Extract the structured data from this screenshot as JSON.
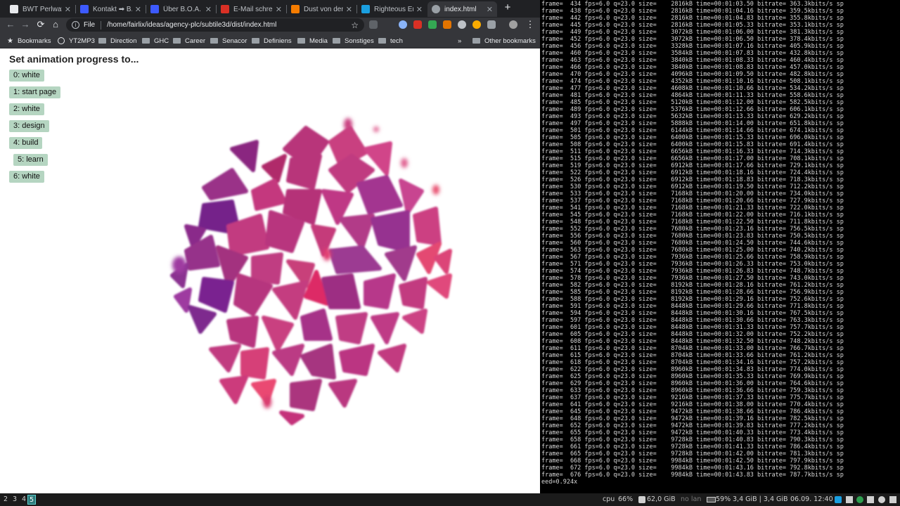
{
  "browser": {
    "tabs": [
      {
        "title": "BWT Perlwater",
        "favicon_color": "#e8eaed",
        "active": false
      },
      {
        "title": "Kontakt ➡ B.O",
        "favicon_color": "#3d5afe",
        "active": false
      },
      {
        "title": "Über B.O.A. Vi",
        "favicon_color": "#3d5afe",
        "active": false
      },
      {
        "title": "E-Mail schreib",
        "favicon_color": "#d93025",
        "active": false
      },
      {
        "title": "Dust von den",
        "favicon_color": "#f57c00",
        "active": false
      },
      {
        "title": "Righteous Ene",
        "favicon_color": "#1a9fe0",
        "active": false
      },
      {
        "title": "index.html",
        "favicon_color": "#9aa0a6",
        "active": true
      }
    ],
    "newtab_label": "+",
    "nav": {
      "back": "←",
      "forward": "→",
      "reload": "⟳",
      "home": "⌂"
    },
    "omnibox": {
      "scheme": "File",
      "url": "/home/fairlix/ideas/agency-plc/subtile3d/dist/index.html",
      "info_icon": "i",
      "star_icon": "☆"
    },
    "menu_icon": "⋮",
    "bookmarks": [
      {
        "label": "Bookmarks",
        "icon": "star-icon"
      },
      {
        "label": "YT2MP3",
        "icon": "globe-icon"
      },
      {
        "label": "Direction",
        "icon": "folder-icon"
      },
      {
        "label": "GHC",
        "icon": "folder-icon"
      },
      {
        "label": "Career",
        "icon": "folder-icon"
      },
      {
        "label": "Senacor",
        "icon": "folder-icon"
      },
      {
        "label": "Definiens",
        "icon": "folder-icon"
      },
      {
        "label": "Media",
        "icon": "folder-icon"
      },
      {
        "label": "Sonstiges",
        "icon": "folder-icon"
      },
      {
        "label": "tech",
        "icon": "folder-icon"
      }
    ],
    "more_bookmarks": "»",
    "other_bookmarks": "Other bookmarks"
  },
  "page": {
    "heading": "Set animation progress to...",
    "buttons": [
      "0: white",
      "1: start page",
      "2: white",
      "3: design",
      "4: build",
      "5: learn",
      "6: white"
    ]
  },
  "terminal": {
    "lines": [
      "frame=  434 fps=6.0 q=23.0 size=    2816kB time=00:01:03.50 bitrate= 363.3kbits/s sp",
      "frame=  438 fps=6.0 q=23.0 size=    2816kB time=00:01:04.16 bitrate= 359.5kbits/s sp",
      "frame=  442 fps=6.0 q=23.0 size=    2816kB time=00:01:04.83 bitrate= 355.8kbits/s sp",
      "frame=  445 fps=6.0 q=23.0 size=    2816kB time=00:01:05.33 bitrate= 353.1kbits/s sp",
      "frame=  449 fps=6.0 q=23.0 size=    3072kB time=00:01:06.00 bitrate= 381.3kbits/s sp",
      "frame=  452 fps=6.0 q=23.0 size=    3072kB time=00:01:06.50 bitrate= 378.4kbits/s sp",
      "frame=  456 fps=6.0 q=23.0 size=    3328kB time=00:01:07.16 bitrate= 405.9kbits/s sp",
      "frame=  460 fps=6.0 q=23.0 size=    3584kB time=00:01:07.83 bitrate= 432.8kbits/s sp",
      "frame=  463 fps=6.0 q=23.0 size=    3840kB time=00:01:08.33 bitrate= 460.4kbits/s sp",
      "frame=  466 fps=6.0 q=23.0 size=    3840kB time=00:01:08.83 bitrate= 457.0kbits/s sp",
      "frame=  470 fps=6.0 q=23.0 size=    4096kB time=00:01:09.50 bitrate= 482.8kbits/s sp",
      "frame=  474 fps=6.0 q=23.0 size=    4352kB time=00:01:10.16 bitrate= 508.1kbits/s sp",
      "frame=  477 fps=6.0 q=23.0 size=    4608kB time=00:01:10.66 bitrate= 534.2kbits/s sp",
      "frame=  481 fps=6.0 q=23.0 size=    4864kB time=00:01:11.33 bitrate= 558.6kbits/s sp",
      "frame=  485 fps=6.0 q=23.0 size=    5120kB time=00:01:12.00 bitrate= 582.5kbits/s sp",
      "frame=  489 fps=6.0 q=23.0 size=    5376kB time=00:01:12.66 bitrate= 606.1kbits/s sp",
      "frame=  493 fps=6.0 q=23.0 size=    5632kB time=00:01:13.33 bitrate= 629.2kbits/s sp",
      "frame=  497 fps=6.0 q=23.0 size=    5888kB time=00:01:14.00 bitrate= 651.8kbits/s sp",
      "frame=  501 fps=6.0 q=23.0 size=    6144kB time=00:01:14.66 bitrate= 674.1kbits/s sp",
      "frame=  505 fps=6.0 q=23.0 size=    6400kB time=00:01:15.33 bitrate= 696.0kbits/s sp",
      "frame=  508 fps=6.0 q=23.0 size=    6400kB time=00:01:15.83 bitrate= 691.4kbits/s sp",
      "frame=  511 fps=6.0 q=23.0 size=    6656kB time=00:01:16.33 bitrate= 714.3kbits/s sp",
      "frame=  515 fps=6.0 q=23.0 size=    6656kB time=00:01:17.00 bitrate= 708.1kbits/s sp",
      "frame=  519 fps=6.0 q=23.0 size=    6912kB time=00:01:17.66 bitrate= 729.1kbits/s sp",
      "frame=  522 fps=6.0 q=23.0 size=    6912kB time=00:01:18.16 bitrate= 724.4kbits/s sp",
      "frame=  526 fps=6.0 q=23.0 size=    6912kB time=00:01:18.83 bitrate= 718.3kbits/s sp",
      "frame=  530 fps=6.0 q=23.0 size=    6912kB time=00:01:19.50 bitrate= 712.2kbits/s sp",
      "frame=  533 fps=6.0 q=23.0 size=    7168kB time=00:01:20.00 bitrate= 734.0kbits/s sp",
      "frame=  537 fps=6.0 q=23.0 size=    7168kB time=00:01:20.66 bitrate= 727.9kbits/s sp",
      "frame=  541 fps=6.0 q=23.0 size=    7168kB time=00:01:21.33 bitrate= 722.0kbits/s sp",
      "frame=  545 fps=6.0 q=23.0 size=    7168kB time=00:01:22.00 bitrate= 716.1kbits/s sp",
      "frame=  548 fps=6.0 q=23.0 size=    7168kB time=00:01:22.50 bitrate= 711.8kbits/s sp",
      "frame=  552 fps=6.0 q=23.0 size=    7680kB time=00:01:23.16 bitrate= 756.5kbits/s sp",
      "frame=  556 fps=6.0 q=23.0 size=    7680kB time=00:01:23.83 bitrate= 750.5kbits/s sp",
      "frame=  560 fps=6.0 q=23.0 size=    7680kB time=00:01:24.50 bitrate= 744.6kbits/s sp",
      "frame=  563 fps=6.0 q=23.0 size=    7680kB time=00:01:25.00 bitrate= 740.2kbits/s sp",
      "frame=  567 fps=6.0 q=23.0 size=    7936kB time=00:01:25.66 bitrate= 758.9kbits/s sp",
      "frame=  571 fps=6.0 q=23.0 size=    7936kB time=00:01:26.33 bitrate= 753.0kbits/s sp",
      "frame=  574 fps=6.0 q=23.0 size=    7936kB time=00:01:26.83 bitrate= 748.7kbits/s sp",
      "frame=  578 fps=6.0 q=23.0 size=    7936kB time=00:01:27.50 bitrate= 743.0kbits/s sp",
      "frame=  582 fps=6.0 q=23.0 size=    8192kB time=00:01:28.16 bitrate= 761.2kbits/s sp",
      "frame=  585 fps=6.0 q=23.0 size=    8192kB time=00:01:28.66 bitrate= 756.9kbits/s sp",
      "frame=  588 fps=6.0 q=23.0 size=    8192kB time=00:01:29.16 bitrate= 752.6kbits/s sp",
      "frame=  591 fps=6.0 q=23.0 size=    8448kB time=00:01:29.66 bitrate= 771.8kbits/s sp",
      "frame=  594 fps=6.0 q=23.0 size=    8448kB time=00:01:30.16 bitrate= 767.5kbits/s sp",
      "frame=  597 fps=6.0 q=23.0 size=    8448kB time=00:01:30.66 bitrate= 763.3kbits/s sp",
      "frame=  601 fps=6.0 q=23.0 size=    8448kB time=00:01:31.33 bitrate= 757.7kbits/s sp",
      "frame=  605 fps=6.0 q=23.0 size=    8448kB time=00:01:32.00 bitrate= 752.2kbits/s sp",
      "frame=  608 fps=6.0 q=23.0 size=    8448kB time=00:01:32.50 bitrate= 748.2kbits/s sp",
      "frame=  611 fps=6.0 q=23.0 size=    8704kB time=00:01:33.00 bitrate= 766.7kbits/s sp",
      "frame=  615 fps=6.0 q=23.0 size=    8704kB time=00:01:33.66 bitrate= 761.2kbits/s sp",
      "frame=  618 fps=6.0 q=23.0 size=    8704kB time=00:01:34.16 bitrate= 757.2kbits/s sp",
      "frame=  622 fps=6.0 q=23.0 size=    8960kB time=00:01:34.83 bitrate= 774.0kbits/s sp",
      "frame=  625 fps=6.0 q=23.0 size=    8960kB time=00:01:35.33 bitrate= 769.9kbits/s sp",
      "frame=  629 fps=6.0 q=23.0 size=    8960kB time=00:01:36.00 bitrate= 764.6kbits/s sp",
      "frame=  633 fps=6.0 q=23.0 size=    8960kB time=00:01:36.66 bitrate= 759.3kbits/s sp",
      "frame=  637 fps=6.0 q=23.0 size=    9216kB time=00:01:37.33 bitrate= 775.7kbits/s sp",
      "frame=  641 fps=6.0 q=23.0 size=    9216kB time=00:01:38.00 bitrate= 770.4kbits/s sp",
      "frame=  645 fps=6.0 q=23.0 size=    9472kB time=00:01:38.66 bitrate= 786.4kbits/s sp",
      "frame=  648 fps=6.0 q=23.0 size=    9472kB time=00:01:39.16 bitrate= 782.5kbits/s sp",
      "frame=  652 fps=6.0 q=23.0 size=    9472kB time=00:01:39.83 bitrate= 777.2kbits/s sp",
      "frame=  655 fps=6.0 q=23.0 size=    9472kB time=00:01:40.33 bitrate= 773.4kbits/s sp",
      "frame=  658 fps=6.0 q=23.0 size=    9728kB time=00:01:40.83 bitrate= 790.3kbits/s sp",
      "frame=  661 fps=6.0 q=23.0 size=    9728kB time=00:01:41.33 bitrate= 786.4kbits/s sp",
      "frame=  665 fps=6.0 q=23.0 size=    9728kB time=00:01:42.00 bitrate= 781.3kbits/s sp",
      "frame=  668 fps=6.0 q=23.0 size=    9984kB time=00:01:42.50 bitrate= 797.9kbits/s sp",
      "frame=  672 fps=6.0 q=23.0 size=    9984kB time=00:01:43.16 bitrate= 792.8kbits/s sp",
      "frame=  676 fps=6.0 q=23.0 size=    9984kB time=00:01:43.83 bitrate= 787.7kbits/s sp"
    ],
    "tail": "eed=0.924x"
  },
  "statusbar": {
    "workspaces": [
      "2",
      "3",
      "4",
      "5"
    ],
    "active_workspace": "5",
    "cpu_label": "cpu",
    "cpu_value": "66%",
    "disk": "62,0 GiB",
    "network": "no lan",
    "battery": "59%",
    "memory": "3,4 GiB | 3,4 GiB",
    "datetime": "06.09. 12:40"
  },
  "colors": {
    "tab_bg": "#202124",
    "toolbar_bg": "#35363a",
    "button_bg": "#b5d5c1",
    "workspace_active": "#2e7b7b"
  }
}
